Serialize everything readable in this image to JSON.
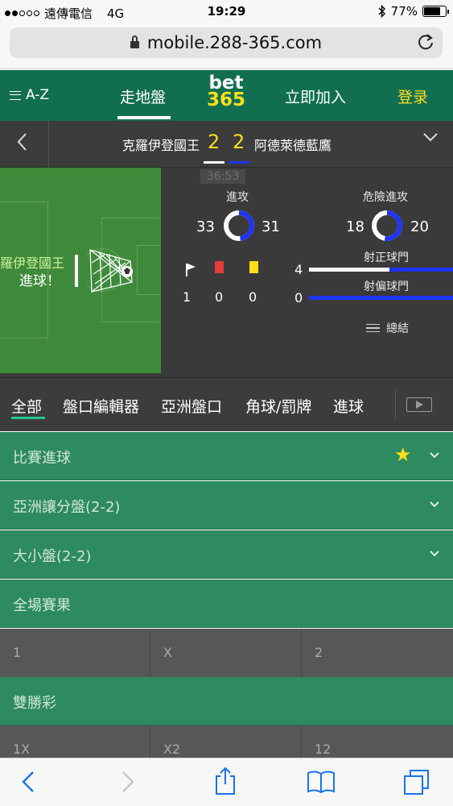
{
  "status": {
    "carrier": "遠傳電信",
    "network": "4G",
    "time": "19:29",
    "battery": "77%",
    "battery_level": 0.77
  },
  "browser": {
    "url": "mobile.288-365.com"
  },
  "nav": {
    "az": "A-Z",
    "inplay": "走地盤",
    "logo_top": "bet",
    "logo_bottom": "365",
    "join": "立即加入",
    "login": "登录"
  },
  "match": {
    "home": "克羅伊登國王",
    "home_score": "2",
    "away_score": "2",
    "away": "阿德萊德藍鷹",
    "timer": "36:53"
  },
  "pitch": {
    "team": "羅伊登國王",
    "event": "進球！"
  },
  "stats": {
    "attacks": {
      "label": "進攻",
      "home": "33",
      "away": "31",
      "home_share": 0.516
    },
    "dangerous": {
      "label": "危險進攻",
      "home": "18",
      "away": "20",
      "home_share": 0.474
    },
    "corners": "1",
    "red_cards": "0",
    "yellow_cards": "0",
    "on_target": {
      "label": "射正球門",
      "home": "4",
      "away": ""
    },
    "off_target": {
      "label": "射偏球門",
      "home": "0",
      "away": ""
    },
    "summary": "總結"
  },
  "tabs": [
    "全部",
    "盤口編輯器",
    "亞洲盤口",
    "角球/罰牌",
    "進球"
  ],
  "markets": [
    {
      "label": "比賽進球"
    },
    {
      "label": "亞洲讓分盤(2-2)"
    },
    {
      "label": "大小盤(2-2)"
    },
    {
      "label": "全場賽果"
    },
    {
      "label": "雙勝彩"
    }
  ],
  "odds_fulltime": [
    "1",
    "X",
    "2"
  ],
  "odds_double": [
    "1X",
    "X2",
    "12"
  ],
  "colors": {
    "brand_green": "#126e51",
    "accent_yellow": "#ffdf1b",
    "away_blue": "#1f35f5",
    "market_green": "#2e8a60"
  }
}
